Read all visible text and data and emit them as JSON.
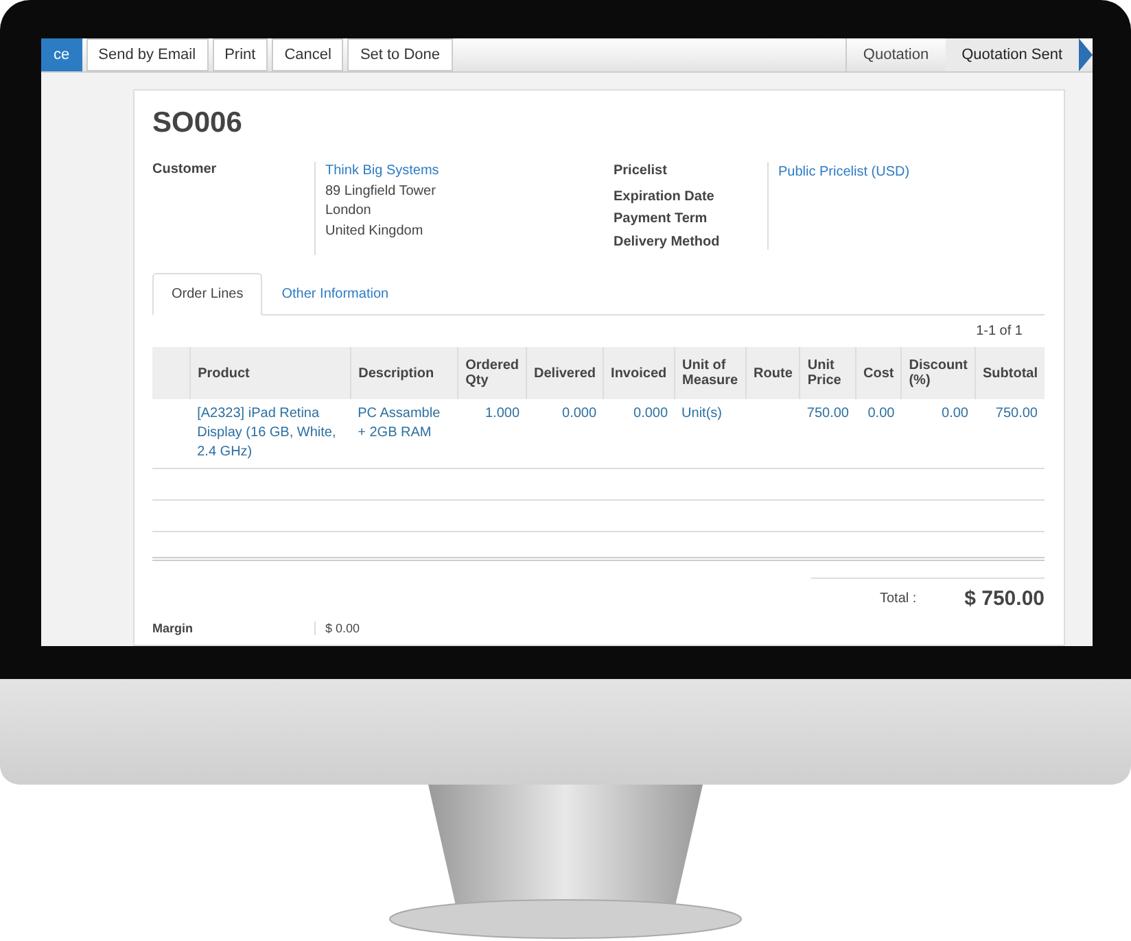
{
  "toolbar": {
    "buttons": [
      {
        "label": "ce",
        "kind": "primary"
      },
      {
        "label": "Send by Email",
        "kind": "default"
      },
      {
        "label": "Print",
        "kind": "default"
      },
      {
        "label": "Cancel",
        "kind": "default"
      },
      {
        "label": "Set to Done",
        "kind": "default"
      }
    ],
    "stages": [
      {
        "label": "Quotation",
        "selected": false
      },
      {
        "label": "Quotation Sent",
        "selected": true
      }
    ]
  },
  "title": "SO006",
  "customer": {
    "label": "Customer",
    "name": "Think Big Systems",
    "address": [
      "89 Lingfield Tower",
      "London",
      "United Kingdom"
    ]
  },
  "fields": [
    {
      "label": "Pricelist",
      "value": "Public Pricelist (USD)"
    },
    {
      "label": "Expiration Date"
    },
    {
      "label": "Payment Term"
    },
    {
      "label": "Delivery Method"
    }
  ],
  "tabs": [
    {
      "label": "Order Lines",
      "selected": true
    },
    {
      "label": "Other Information",
      "selected": false
    }
  ],
  "pager": "1-1 of 1",
  "table": {
    "columns": [
      "Product",
      "Description",
      "Ordered Qty",
      "Delivered",
      "Invoiced",
      "Unit of Measure",
      "Route",
      "Unit Price",
      "Cost",
      "Discount (%)",
      "Subtotal"
    ],
    "rows": [
      [
        "[A2323] iPad Retina Display (16 GB, White, 2.4 GHz)",
        "PC Assamble + 2GB RAM",
        "1.000",
        "0.000",
        "0.000",
        "Unit(s)",
        "",
        "750.00",
        "0.00",
        "0.00",
        "750.00"
      ]
    ]
  },
  "total": {
    "label": "Total :",
    "value": "$ 750.00"
  },
  "margin": {
    "label": "Margin",
    "value": "$ 0.00"
  }
}
